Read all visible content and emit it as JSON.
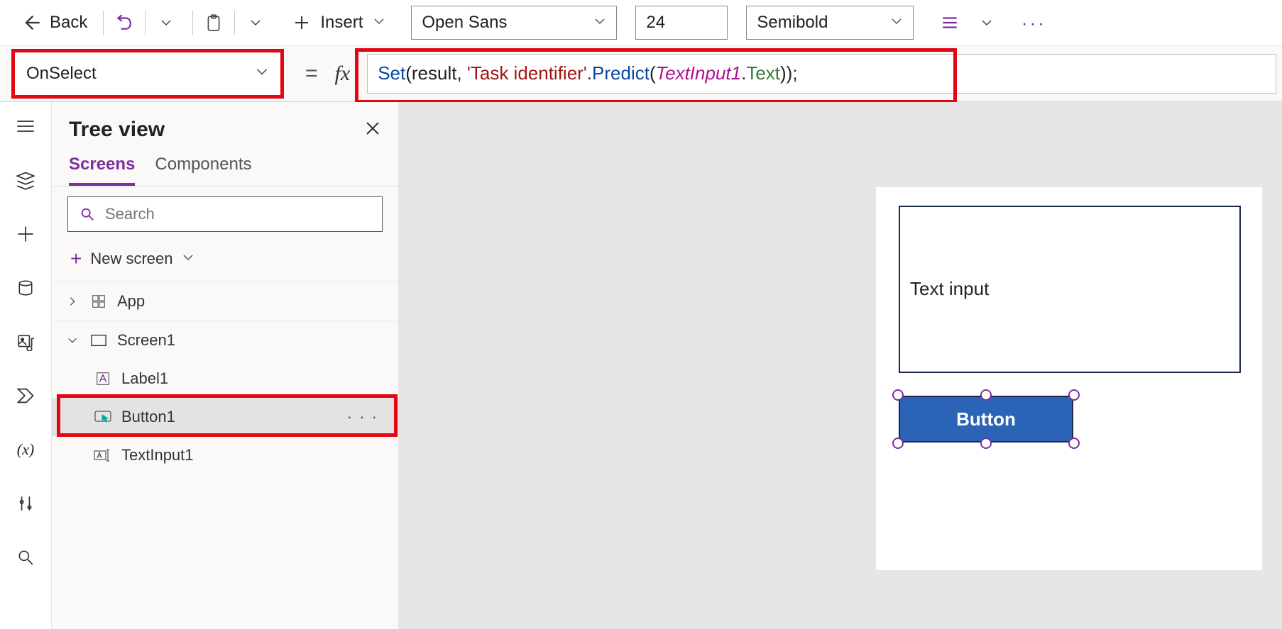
{
  "toolbar": {
    "back_label": "Back",
    "insert_label": "Insert",
    "font_family": "Open Sans",
    "font_size": "24",
    "font_weight": "Semibold"
  },
  "formulabar": {
    "property": "OnSelect",
    "tokens": {
      "set": "Set",
      "open1": "(result, ",
      "str": "'Task identifier'",
      "dot1": ".",
      "predict": "Predict",
      "open2": "(",
      "var": "TextInput1",
      "dot2": ".",
      "prop": "Text",
      "close": "));"
    }
  },
  "tree": {
    "title": "Tree view",
    "tabs": {
      "screens": "Screens",
      "components": "Components"
    },
    "search_placeholder": "Search",
    "new_screen": "New screen",
    "nodes": {
      "app": "App",
      "screen1": "Screen1",
      "label1": "Label1",
      "button1": "Button1",
      "textinput1": "TextInput1"
    }
  },
  "canvas": {
    "textinput_value": "Text input",
    "button_label": "Button"
  }
}
